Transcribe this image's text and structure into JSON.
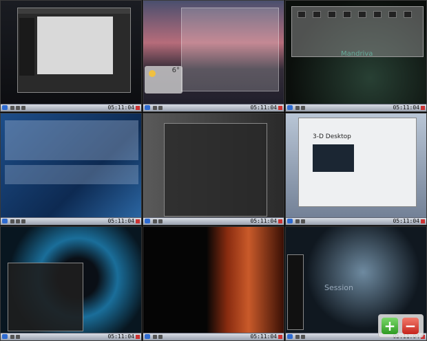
{
  "desktops": [
    {
      "id": 1,
      "clock": "05:11:04",
      "wallpaper": "night-city-dark-panel"
    },
    {
      "id": 2,
      "clock": "05:11:04",
      "wallpaper": "sunset-lake",
      "weather_temp": "6°"
    },
    {
      "id": 3,
      "clock": "05:11:04",
      "wallpaper": "mandriva-dark",
      "brand": "Mandriva"
    },
    {
      "id": 4,
      "clock": "05:11:04",
      "wallpaper": "blue-abstract"
    },
    {
      "id": 5,
      "clock": "05:11:04",
      "wallpaper": "collage"
    },
    {
      "id": 6,
      "clock": "05:11:04",
      "wallpaper": "snow-mountains",
      "doc_title": "3-D Desktop"
    },
    {
      "id": 7,
      "clock": "05:11:04",
      "wallpaper": "blue-swirl"
    },
    {
      "id": 8,
      "clock": "05:11:04",
      "wallpaper": "red-hair-portrait"
    },
    {
      "id": 9,
      "clock": "05:11:04",
      "wallpaper": "dark-abstract",
      "caption": "Session"
    }
  ],
  "zoom_controls": {
    "zoom_in": "+",
    "zoom_out": "−"
  },
  "colors": {
    "zoom_in": "#3aa52d",
    "zoom_out": "#d2322a",
    "panel": "#b4bac6"
  }
}
